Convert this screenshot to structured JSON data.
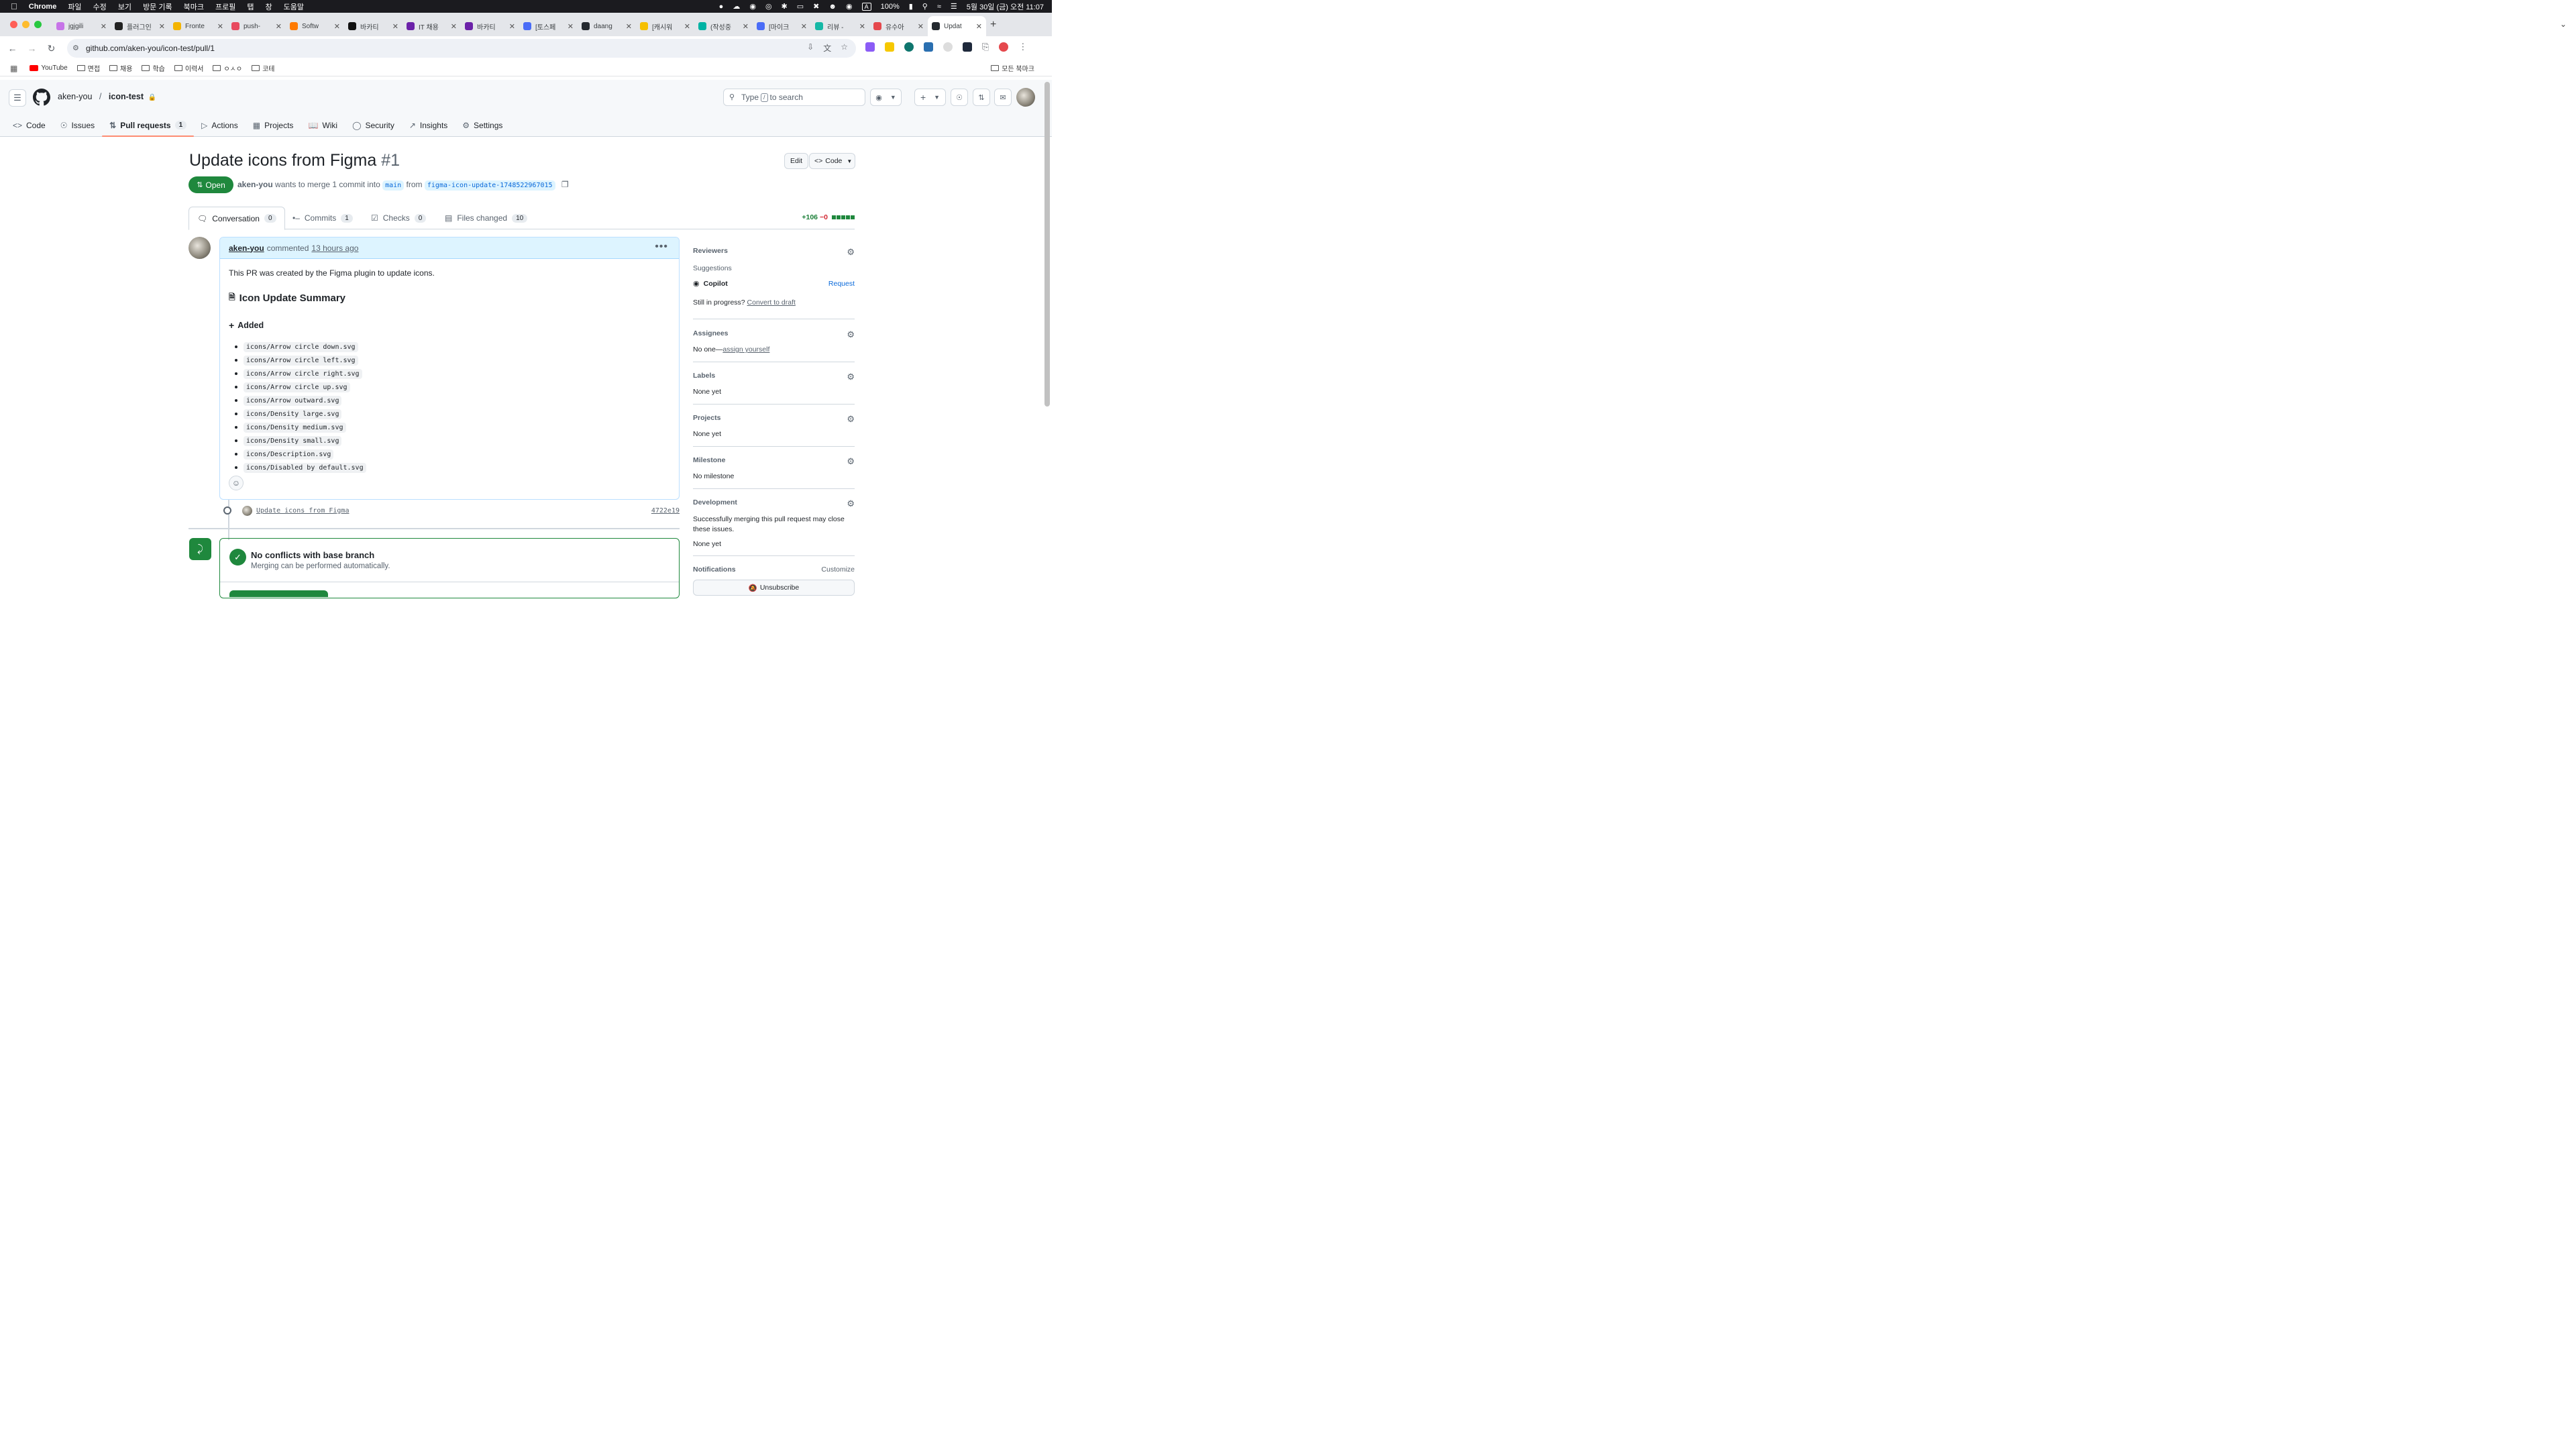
{
  "menubar": {
    "app": "Chrome",
    "items": [
      "파일",
      "수정",
      "보기",
      "방문 기록",
      "북마크",
      "프로필",
      "탭",
      "창",
      "도움말"
    ],
    "battery": "100%",
    "datetime": "5월 30일 (금) 오전 11:07"
  },
  "tabs": [
    {
      "title": "jgjgili",
      "color": "#c774e8"
    },
    {
      "title": "플러그인",
      "color": "#222222"
    },
    {
      "title": "Fronte",
      "color": "#f4b400"
    },
    {
      "title": "push-",
      "color": "#e84a5f"
    },
    {
      "title": "Softw",
      "color": "#ff7a00"
    },
    {
      "title": "바카티",
      "color": "#111111"
    },
    {
      "title": "IT 채용",
      "color": "#6b21a8"
    },
    {
      "title": "바카티",
      "color": "#6b21a8"
    },
    {
      "title": "[토스페",
      "color": "#4a6cf7"
    },
    {
      "title": "daang",
      "color": "#24292f"
    },
    {
      "title": "[캐시워",
      "color": "#f6c000"
    },
    {
      "title": "(작성중",
      "color": "#00b3a4"
    },
    {
      "title": "[마이크",
      "color": "#4a6cf7"
    },
    {
      "title": "리뷰 -",
      "color": "#16b8a6"
    },
    {
      "title": "유수아",
      "color": "#e5484d"
    },
    {
      "title": "Updat",
      "color": "#24292f"
    }
  ],
  "address": {
    "url": "github.com/aken-you/icon-test/pull/1"
  },
  "bookmarks": [
    {
      "label": "YouTube",
      "type": "youtube"
    },
    {
      "label": "면접",
      "type": "folder"
    },
    {
      "label": "채용",
      "type": "folder"
    },
    {
      "label": "학습",
      "type": "folder"
    },
    {
      "label": "이력서",
      "type": "folder"
    },
    {
      "label": "ㅇㅅㅇ",
      "type": "folder"
    },
    {
      "label": "코테",
      "type": "folder"
    }
  ],
  "bookmarks_right": "모든 북마크",
  "header": {
    "owner": "aken-you",
    "repo": "icon-test",
    "search_text": "Type",
    "search_key": "/",
    "search_suffix": "to search"
  },
  "repo_nav": [
    {
      "label": "Code",
      "icon": "code-icon"
    },
    {
      "label": "Issues",
      "icon": "issue-icon"
    },
    {
      "label": "Pull requests",
      "icon": "pull-request-icon",
      "count": "1",
      "selected": true
    },
    {
      "label": "Actions",
      "icon": "play-icon"
    },
    {
      "label": "Projects",
      "icon": "table-icon"
    },
    {
      "label": "Wiki",
      "icon": "book-icon"
    },
    {
      "label": "Security",
      "icon": "shield-icon"
    },
    {
      "label": "Insights",
      "icon": "graph-icon"
    },
    {
      "label": "Settings",
      "icon": "gear-icon"
    }
  ],
  "pr": {
    "title": "Update icons from Figma",
    "number": "#1",
    "edit_label": "Edit",
    "code_label": "Code",
    "state": "Open",
    "author": "aken-you",
    "meta_mid": "wants to merge 1 commit into",
    "base": "main",
    "meta_from": "from",
    "head": "figma-icon-update-1748522967015"
  },
  "pr_tabs": [
    {
      "label": "Conversation",
      "count": "0",
      "icon": "comment-icon"
    },
    {
      "label": "Commits",
      "count": "1",
      "icon": "commit-icon"
    },
    {
      "label": "Checks",
      "count": "0",
      "icon": "checklist-icon"
    },
    {
      "label": "Files changed",
      "count": "10",
      "icon": "file-diff-icon"
    }
  ],
  "diffstat": {
    "additions": "+106",
    "deletions": "−0"
  },
  "comment": {
    "author": "aken-you",
    "action": "commented",
    "time": "13 hours ago",
    "intro": "This PR was created by the Figma plugin to update icons.",
    "summary_heading": "Icon Update Summary",
    "added_heading": "Added",
    "files": [
      "icons/Arrow circle down.svg",
      "icons/Arrow circle left.svg",
      "icons/Arrow circle right.svg",
      "icons/Arrow circle up.svg",
      "icons/Arrow outward.svg",
      "icons/Density large.svg",
      "icons/Density medium.svg",
      "icons/Density small.svg",
      "icons/Description.svg",
      "icons/Disabled by default.svg"
    ]
  },
  "commit": {
    "message": "Update icons from Figma",
    "sha": "4722e19"
  },
  "merge": {
    "title": "No conflicts with base branch",
    "subtitle": "Merging can be performed automatically."
  },
  "sidebar": {
    "reviewers_label": "Reviewers",
    "suggestions_label": "Suggestions",
    "copilot_label": "Copilot",
    "request_label": "Request",
    "in_progress": "Still in progress?",
    "convert_draft": "Convert to draft",
    "assignees_label": "Assignees",
    "assignees_value": "No one—",
    "assign_yourself": "assign yourself",
    "labels_label": "Labels",
    "labels_value": "None yet",
    "projects_label": "Projects",
    "projects_value": "None yet",
    "milestone_label": "Milestone",
    "milestone_value": "No milestone",
    "development_label": "Development",
    "development_desc": "Successfully merging this pull request may close these issues.",
    "development_value": "None yet",
    "notifications_label": "Notifications",
    "customize_label": "Customize",
    "unsubscribe_label": "Unsubscribe"
  }
}
